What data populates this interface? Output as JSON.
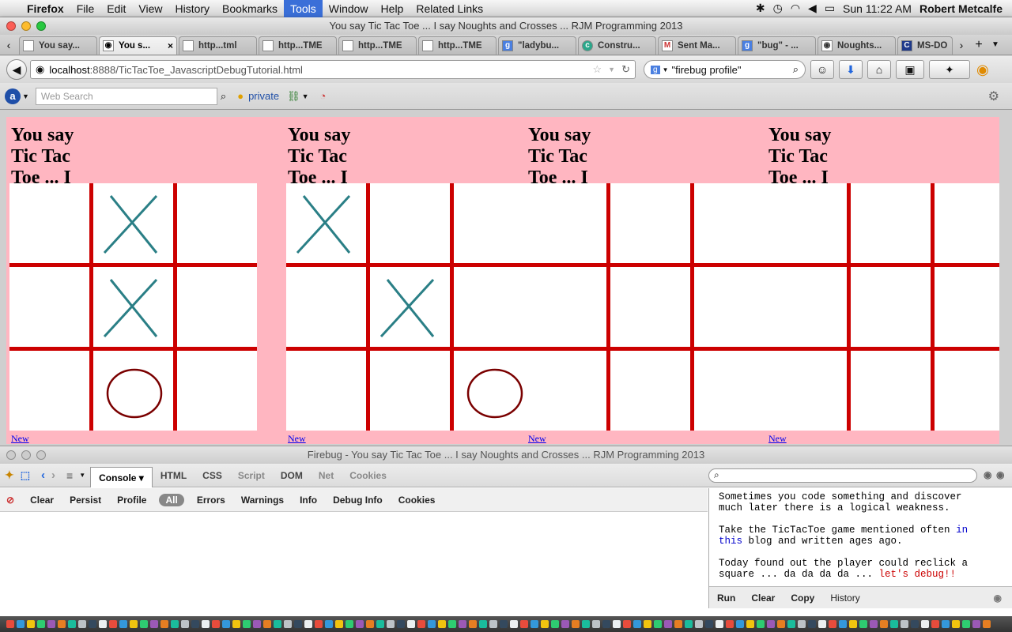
{
  "menubar": {
    "app": "Firefox",
    "items": [
      "File",
      "Edit",
      "View",
      "History",
      "Bookmarks",
      "Tools",
      "Window",
      "Help",
      "Related Links"
    ],
    "active": "Tools",
    "clock": "Sun 11:22 AM",
    "user": "Robert Metcalfe"
  },
  "window": {
    "title": "You say Tic Tac Toe ... I say Noughts and Crosses ... RJM Programming 2013",
    "tabs": [
      {
        "label": "You say..."
      },
      {
        "label": "You s...",
        "selected": true
      },
      {
        "label": "http...tml"
      },
      {
        "label": "http...TME"
      },
      {
        "label": "http...TME"
      },
      {
        "label": "http...TME"
      },
      {
        "label": "\"ladybu..."
      },
      {
        "label": "Constru..."
      },
      {
        "label": "Sent Ma..."
      },
      {
        "label": "\"bug\" - ..."
      },
      {
        "label": "Noughts..."
      },
      {
        "label": "MS-DO"
      }
    ],
    "url_host": "localhost",
    "url_path": ":8888/TicTacToe_JavascriptDebugTutorial.html",
    "search_value": "\"firebug profile\"",
    "websearch_placeholder": "Web Search",
    "private_label": "private"
  },
  "page": {
    "boards": [
      {
        "heading": "You say Tic Tac Toe ... I say Noughts and Crosses",
        "cells": [
          "",
          "X",
          "",
          "",
          "X",
          "",
          "",
          "O",
          ""
        ],
        "newgame": "New game"
      },
      {
        "heading": "You say Tic Tac Toe ... I say Noughts and Crosses",
        "cells": [
          "X",
          "",
          "",
          "",
          "X",
          "",
          "",
          "",
          "O"
        ],
        "newgame": "New game"
      },
      {
        "heading": "You say Tic Tac Toe ... I say Noughts and Crosses",
        "cells": [
          "",
          "",
          "",
          "",
          "",
          "",
          "",
          "",
          ""
        ],
        "newgame": "New game"
      },
      {
        "heading": "You say Tic Tac Toe ... I say Noughts and Crosses",
        "cells": [
          "",
          "",
          "",
          "",
          "",
          "",
          "",
          "",
          ""
        ],
        "newgame": "New game"
      }
    ],
    "colors": {
      "x": "#2a7f86",
      "o": "#7a0000",
      "grid": "#cc0000",
      "bg": "#ffb6c1"
    }
  },
  "firebug": {
    "title": "Firebug - You say Tic Tac Toe ... I say Noughts and Crosses ... RJM Programming 2013",
    "panels": [
      "Console",
      "HTML",
      "CSS",
      "Script",
      "DOM",
      "Net",
      "Cookies"
    ],
    "console_buttons": [
      "Clear",
      "Persist",
      "Profile",
      "All",
      "Errors",
      "Warnings",
      "Info",
      "Debug Info",
      "Cookies"
    ],
    "note_p1": "Sometimes you code something and discover much later there is a logical weakness.",
    "note_p2a": "Take the TicTacToe game mentioned often ",
    "note_p2b": "in this",
    "note_p2c": " blog and written ages ago.",
    "note_p3a": "Today found out the player could reclick a square ... da da da da ... ",
    "note_p3b": "let's debug!!",
    "run_buttons": [
      "Run",
      "Clear",
      "Copy",
      "History"
    ]
  }
}
